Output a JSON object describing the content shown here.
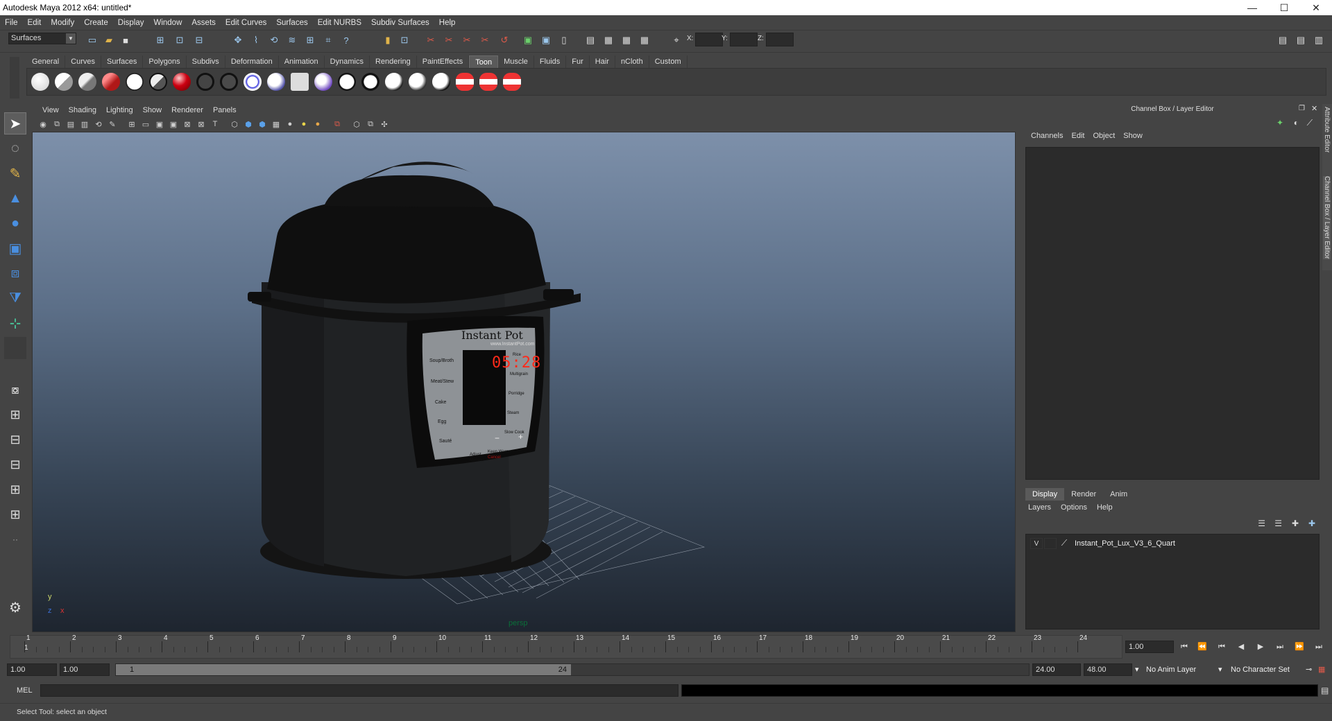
{
  "window": {
    "title": "Autodesk Maya 2012 x64: untitled*"
  },
  "menubar": [
    "File",
    "Edit",
    "Modify",
    "Create",
    "Display",
    "Window",
    "Assets",
    "Edit Curves",
    "Surfaces",
    "Edit NURBS",
    "Subdiv Surfaces",
    "Help"
  ],
  "statusline": {
    "mode": "Surfaces",
    "x_label": "X:",
    "y_label": "Y:",
    "z_label": "Z:"
  },
  "shelf": {
    "tabs": [
      "General",
      "Curves",
      "Surfaces",
      "Polygons",
      "Subdivs",
      "Deformation",
      "Animation",
      "Dynamics",
      "Rendering",
      "PaintEffects",
      "Toon",
      "Muscle",
      "Fluids",
      "Fur",
      "Hair",
      "nCloth",
      "Custom"
    ],
    "active_tab": "Toon"
  },
  "viewport": {
    "menus": [
      "View",
      "Shading",
      "Lighting",
      "Show",
      "Renderer",
      "Panels"
    ],
    "camera": "persp",
    "axis": {
      "y": "y",
      "x": "x",
      "z": "z"
    },
    "model": {
      "brand": "Instant Pot",
      "url": "www.InstantPot.com",
      "display_time": "05:28",
      "left_buttons": [
        "Soup/Broth",
        "Meat/Stew",
        "Cake",
        "Egg",
        "Sauté"
      ],
      "right_buttons": [
        "Rice",
        "Multigrain",
        "Porridge",
        "Steam",
        "Slow Cook"
      ],
      "center_buttons": [
        "Adjust",
        "Keep Warm",
        "Manual",
        "Cancel"
      ],
      "minus": "−",
      "plus": "+"
    }
  },
  "channel_box": {
    "title": "Channel Box / Layer Editor",
    "menus": [
      "Channels",
      "Edit",
      "Object",
      "Show"
    ]
  },
  "layer_editor": {
    "tabs": [
      "Display",
      "Render",
      "Anim"
    ],
    "active_tab": "Display",
    "menus": [
      "Layers",
      "Options",
      "Help"
    ],
    "layers": [
      {
        "visible": "V",
        "name": "Instant_Pot_Lux_V3_6_Quart"
      }
    ]
  },
  "side_tabs": [
    "Attribute Editor",
    "Channel Box / Layer Editor"
  ],
  "timeline": {
    "frames": [
      "1",
      "2",
      "3",
      "4",
      "5",
      "6",
      "7",
      "8",
      "9",
      "10",
      "11",
      "12",
      "13",
      "14",
      "15",
      "16",
      "17",
      "18",
      "19",
      "20",
      "21",
      "22",
      "23",
      "24"
    ],
    "current_frame_marker": "1",
    "current_frame": "1.00"
  },
  "range": {
    "start_time": "1.00",
    "playback_start": "1.00",
    "slider_start": "1",
    "slider_end": "24",
    "playback_end": "24.00",
    "end_time": "48.00",
    "anim_layer": "No Anim Layer",
    "character_set": "No Character Set"
  },
  "command_line": {
    "label": "MEL"
  },
  "help_line": {
    "text": "Select Tool: select an object"
  },
  "colors": {
    "bg": "#444444",
    "field": "#2b2b2b",
    "active_tab": "#5a5a5a",
    "lcd_red": "#ff2a1a"
  }
}
